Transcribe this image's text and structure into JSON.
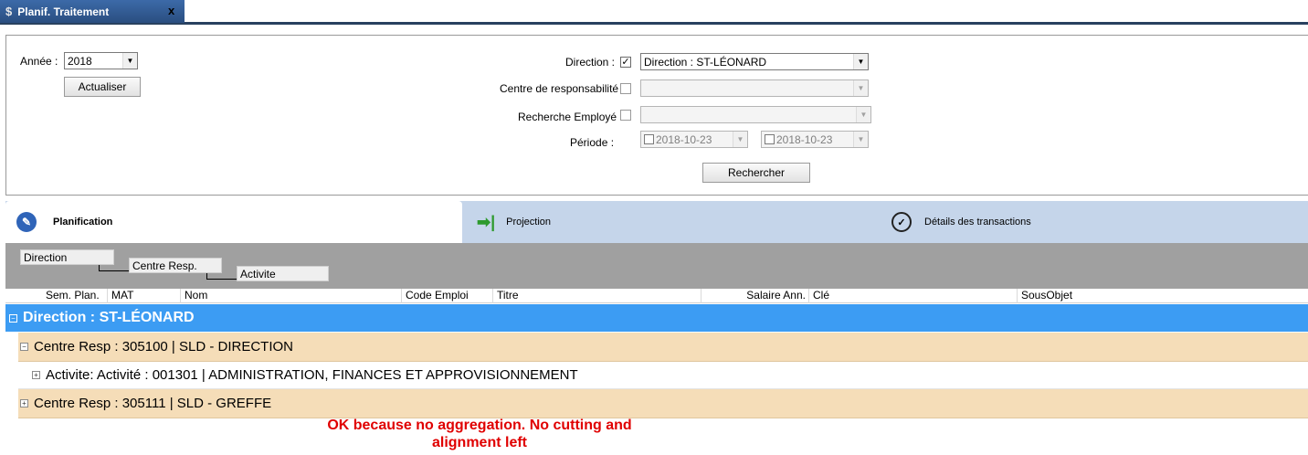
{
  "window": {
    "tab_title": "Planif. Traitement",
    "tab_icon": "$",
    "close_glyph": "x"
  },
  "filters": {
    "annee_label": "Année :",
    "annee_value": "2018",
    "actualiser_label": "Actualiser",
    "direction_label": "Direction :",
    "direction_checked": true,
    "direction_value": "Direction : ST-LÉONARD",
    "centre_label": "Centre de responsabilité :",
    "centre_checked": false,
    "centre_value": "",
    "employe_label": "Recherche Employé :",
    "employe_checked": false,
    "employe_value": "",
    "periode_label": "Période :",
    "periode_from": "2018-10-23",
    "periode_to": "2018-10-23",
    "rechercher_label": "Rechercher"
  },
  "module_tabs": [
    {
      "label": "Planification",
      "icon": "pen-circle-icon",
      "active": true
    },
    {
      "label": "Projection",
      "icon": "arrow-right-icon",
      "active": false
    },
    {
      "label": "Détails des transactions",
      "icon": "clock-check-icon",
      "active": false
    }
  ],
  "grouping": [
    "Direction",
    "Centre Resp.",
    "Activite"
  ],
  "columns": [
    "Sem. Plan.",
    "MAT",
    "Nom",
    "Code Emploi",
    "Titre",
    "Salaire Ann.",
    "Clé",
    "SousObjet"
  ],
  "rows": {
    "direction": "Direction : ST-LÉONARD",
    "centre1": "Centre Resp : 305100 | SLD - DIRECTION",
    "activite1": "Activite: Activité : 001301 | ADMINISTRATION, FINANCES ET APPROVISIONNEMENT",
    "centre2": "Centre Resp : 305111 | SLD - GREFFE"
  },
  "note": {
    "line1": "OK because no aggregation. No cutting and",
    "line2": "alignment left"
  },
  "colors": {
    "direction_row": "#3c9cf3",
    "centre_row": "#f5ddb8",
    "note": "#e00000"
  }
}
